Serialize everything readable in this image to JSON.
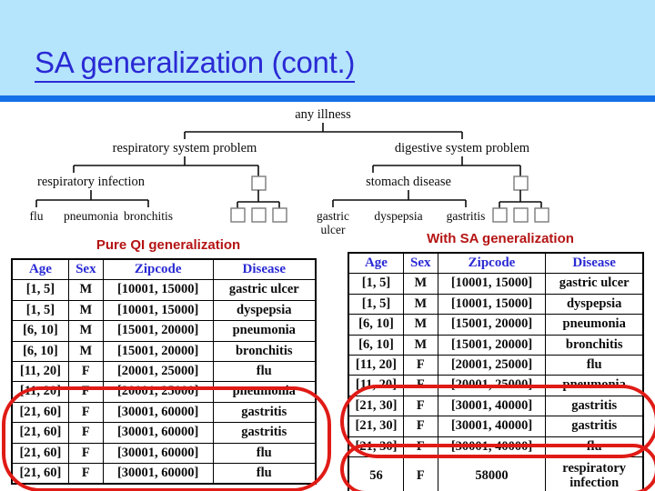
{
  "slide": {
    "title": "SA generalization (cont.)",
    "title_color": "#2a2ad4",
    "header_bg": "#b5e4fd",
    "header_rule_color": "#1571e8",
    "caption_color": "#b51414",
    "highlight_color": "#e01b16"
  },
  "tree": {
    "root": "any illness",
    "level1": [
      "respiratory system problem",
      "digestive system problem"
    ],
    "level2": [
      "respiratory infection",
      "stomach disease"
    ],
    "level3": [
      "flu",
      "pneumonia",
      "bronchitis",
      "gastric ulcer",
      "dyspepsia",
      "gastritis"
    ],
    "gastric_ulcer_line1": "gastric",
    "gastric_ulcer_line2": "ulcer",
    "anonymous_node_label": ""
  },
  "left_panel": {
    "caption": "Pure QI generalization",
    "columns": [
      "Age",
      "Sex",
      "Zipcode",
      "Disease"
    ],
    "rows": [
      [
        "[1, 5]",
        "M",
        "[10001, 15000]",
        "gastric ulcer"
      ],
      [
        "[1, 5]",
        "M",
        "[10001, 15000]",
        "dyspepsia"
      ],
      [
        "[6, 10]",
        "M",
        "[15001, 20000]",
        "pneumonia"
      ],
      [
        "[6, 10]",
        "M",
        "[15001, 20000]",
        "bronchitis"
      ],
      [
        "[11, 20]",
        "F",
        "[20001, 25000]",
        "flu"
      ],
      [
        "[11, 20]",
        "F",
        "[20001, 25000]",
        "pneumonia"
      ],
      [
        "[21, 60]",
        "F",
        "[30001, 60000]",
        "gastritis"
      ],
      [
        "[21, 60]",
        "F",
        "[30001, 60000]",
        "gastritis"
      ],
      [
        "[21, 60]",
        "F",
        "[30001, 60000]",
        "flu"
      ],
      [
        "[21, 60]",
        "F",
        "[30001, 60000]",
        "flu"
      ]
    ]
  },
  "right_panel": {
    "caption": "With SA generalization",
    "columns": [
      "Age",
      "Sex",
      "Zipcode",
      "Disease"
    ],
    "rows": [
      [
        "[1, 5]",
        "M",
        "[10001, 15000]",
        "gastric ulcer"
      ],
      [
        "[1, 5]",
        "M",
        "[10001, 15000]",
        "dyspepsia"
      ],
      [
        "[6, 10]",
        "M",
        "[15001, 20000]",
        "pneumonia"
      ],
      [
        "[6, 10]",
        "M",
        "[15001, 20000]",
        "bronchitis"
      ],
      [
        "[11, 20]",
        "F",
        "[20001, 25000]",
        "flu"
      ],
      [
        "[11, 20]",
        "F",
        "[20001, 25000]",
        "pneumonia"
      ],
      [
        "[21, 30]",
        "F",
        "[30001, 40000]",
        "gastritis"
      ],
      [
        "[21, 30]",
        "F",
        "[30001, 40000]",
        "gastritis"
      ],
      [
        "[21, 30]",
        "F",
        "[30001, 40000]",
        "flu"
      ]
    ],
    "last_row": [
      "56",
      "F",
      "58000",
      "respiratory infection"
    ],
    "last_row_disease_line1": "respiratory",
    "last_row_disease_line2": "infection"
  }
}
